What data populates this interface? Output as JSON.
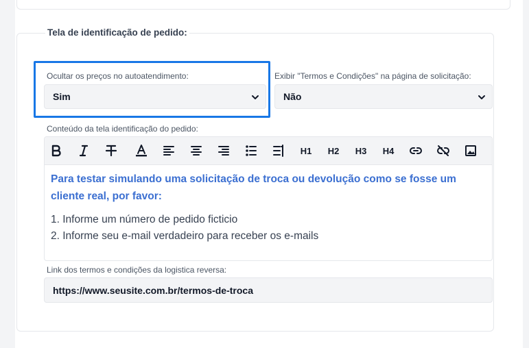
{
  "section": {
    "title": "Tela de identificação de pedido:"
  },
  "hide_prices": {
    "label": "Ocultar os preços no autoatendimento:",
    "value": "Sim"
  },
  "show_terms": {
    "label": "Exibir \"Termos e Condições\" na página de solicitação:",
    "value": "Não"
  },
  "editor": {
    "label": "Conteúdo da tela identificação do pedido:",
    "toolbar": {
      "h1": "H1",
      "h2": "H2",
      "h3": "H3",
      "h4": "H4"
    },
    "content": {
      "heading": "Para testar simulando uma solicitação de troca ou devolução como se fosse um cliente real, por favor:",
      "line1": "1. Informe um número de pedido ficticio",
      "line2": "2. Informe seu e-mail verdadeiro para receber os e-mails"
    }
  },
  "terms_link": {
    "label": "Link dos termos e condições da logistica reversa:",
    "value": "https://www.seusite.com.br/termos-de-troca"
  },
  "colors": {
    "accent_highlight": "#1877e6",
    "heading_blue": "#3b6fd1"
  },
  "icons": [
    "bold-icon",
    "italic-icon",
    "strikethrough-icon",
    "text-color-icon",
    "align-left-icon",
    "align-center-icon",
    "align-right-icon",
    "bullet-list-icon",
    "numbered-list-icon",
    "link-icon",
    "unlink-icon",
    "image-icon",
    "chevron-down-icon"
  ]
}
